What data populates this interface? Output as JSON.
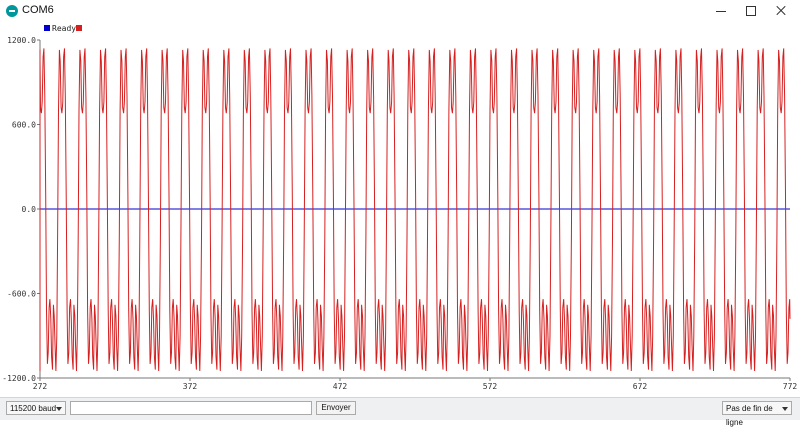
{
  "window": {
    "title": "COM6"
  },
  "legend": {
    "items": [
      {
        "label": "Ready",
        "color": "#0000cc"
      },
      {
        "label": "",
        "color": "#d62020"
      }
    ]
  },
  "controls": {
    "baud_rate": "115200 baud",
    "message_value": "",
    "send_label": "Envoyer",
    "line_ending": "Pas de fin de ligne"
  },
  "chart_data": {
    "type": "line",
    "title": "",
    "xlabel": "",
    "ylabel": "",
    "ylim": [
      -1200,
      1200
    ],
    "xlim": [
      272,
      772
    ],
    "y_ticks": [
      "1200.0",
      "600.0",
      "0.0",
      "-600.0",
      "-1200.0"
    ],
    "x_ticks": [
      "272",
      "372",
      "472",
      "572",
      "672",
      "772"
    ],
    "grid": true,
    "legend_position": "top-left",
    "series": [
      {
        "name": "Ready",
        "color": "#0000cc",
        "values": [
          0,
          0,
          0,
          0,
          0,
          0,
          0,
          0,
          0,
          0,
          0,
          0,
          0,
          0,
          0,
          0,
          0,
          0,
          0,
          0
        ]
      },
      {
        "color": "#d62020",
        "period_samples": 13.7,
        "values": [
          -680,
          -760,
          -980,
          -1150,
          -900,
          -200,
          700,
          1130,
          1050,
          720,
          680,
          760,
          1080,
          1140,
          800,
          100,
          -720,
          -1100,
          -1020,
          -700,
          -640,
          -780,
          -1050,
          -1140,
          -760
        ]
      }
    ]
  }
}
